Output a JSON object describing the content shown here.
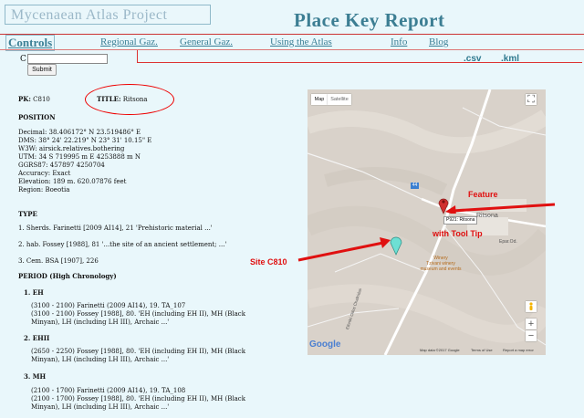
{
  "header": {
    "project_title": "Mycenaean Atlas Project",
    "page_title": "Place Key Report"
  },
  "nav": {
    "controls": "Controls",
    "items": [
      "Regional Gaz.",
      "General Gaz.",
      "Using the Atlas",
      "Info",
      "Blog"
    ]
  },
  "exports": {
    "csv": ".csv",
    "kml": ".kml"
  },
  "search": {
    "label": "C",
    "value": "",
    "submit": "Submit"
  },
  "record": {
    "pk_label": "PK:",
    "pk_value": "C810",
    "title_label": "TITLE:",
    "title_value": "Ritsona",
    "position_heading": "POSITION",
    "position_lines": [
      "Decimal:  38.406172° N         23.519486° E",
      "DMS:        38° 24' 22.219\" N       23° 31' 10.15\" E",
      "W3W:          airsick.relatives.bothering",
      "UTM:       34 S    719995 m E    4253888 m N",
      "GGRS87:       457897    4250704",
      "Accuracy: Exact",
      "Elevation:  189 m.         620.07876 feet",
      "Region:   Boeotia"
    ],
    "type_heading": "TYPE",
    "type_lines": [
      "1.    Sherds.   Farinetti [2009 AI14], 21      'Prehistoric material ...'",
      "2.    hab.    Fossey [1988], 81     '...the site of an ancient settlement; ...'",
      "3.    Cem.    BSA [1907], 226"
    ],
    "period_heading": "PERIOD (High Chronology)",
    "periods": [
      {
        "label": "1. EH",
        "lines": [
          "(3100 - 2100) Farinetti (2009 AI14), 19. TA_107",
          "(3100 - 2100) Fossey [1988], 80. 'EH (including EH II), MH (Black",
          "Minyan), LH (including LH III), Archaic ...'"
        ]
      },
      {
        "label": "2. EHII",
        "lines": [
          "(2650 - 2250) Fossey [1988], 80. 'EH (including EH II), MH (Black",
          "Minyan), LH (including LH III), Archaic ...'"
        ]
      },
      {
        "label": "3. MH",
        "lines": [
          "(2100 - 1700) Farinetti (2009 AI14), 19. TA_108",
          "(2100 - 1700) Fossey [1988], 80. 'EH (including EH II), MH (Black",
          "Minyan), LH (including LH III), Archaic ...'"
        ]
      }
    ]
  },
  "map": {
    "btn_map": "Map",
    "btn_satellite": "Satellite",
    "tooltip": "P921: Ritsona",
    "place_label": "Ritsona",
    "place_label2": "Epar.Od.",
    "road_label": "Ethnikí Odos Chalkídas",
    "winery": "Winery\nTzivani winery\nmuseum and events",
    "road_badge": "44",
    "footer": [
      "Map data ©2017 Google",
      "Terms of Use",
      "Report a map error"
    ],
    "google": "Google",
    "zoom_in": "+",
    "zoom_out": "−",
    "fullscreen_icon": "fullscreen-icon",
    "pegman_icon": "pegman-icon"
  },
  "annotations": {
    "feature": "Feature",
    "tooltip_note": "with Tool Tip",
    "site": "Site C810"
  },
  "colors": {
    "accent": "#3c7e93",
    "annotation_red": "#e01010",
    "red_marker": "#d03030",
    "cyan_marker": "#6de0d4"
  }
}
